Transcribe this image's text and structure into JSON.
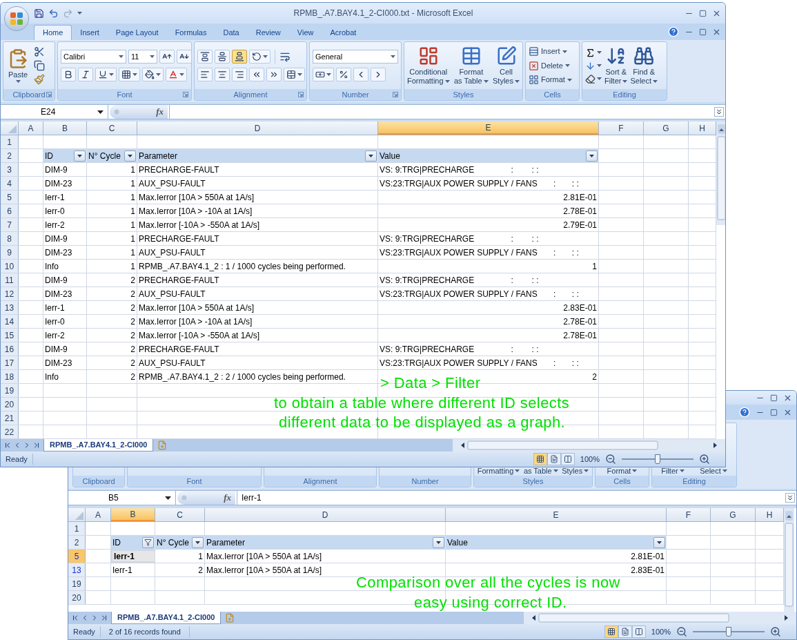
{
  "window_1": {
    "title": "RPMB_.A7.BAY4.1_2-CI000.txt - Microsoft Excel",
    "tabs": [
      {
        "label": "Home",
        "selected": true
      },
      {
        "label": "Insert",
        "selected": false
      },
      {
        "label": "Page Layout",
        "selected": false
      },
      {
        "label": "Formulas",
        "selected": false
      },
      {
        "label": "Data",
        "selected": false
      },
      {
        "label": "Review",
        "selected": false
      },
      {
        "label": "View",
        "selected": false
      },
      {
        "label": "Acrobat",
        "selected": false
      }
    ],
    "ribbon": {
      "groups": [
        {
          "kind": "clipboard",
          "label": "Clipboard",
          "paste": "Paste"
        },
        {
          "kind": "font",
          "label": "Font",
          "font_name": "Calibri",
          "font_size": "11"
        },
        {
          "kind": "alignment",
          "label": "Alignment",
          "vertical_align": [
            {
              "kind": "top",
              "selected": false
            },
            {
              "kind": "middle",
              "selected": false
            },
            {
              "kind": "bottom",
              "selected": true
            }
          ]
        },
        {
          "kind": "number",
          "label": "Number",
          "format": "General"
        },
        {
          "kind": "styles",
          "label": "Styles",
          "buttons": [
            {
              "kind": "conditional",
              "lines": [
                "Conditional",
                "Formatting"
              ]
            },
            {
              "kind": "table",
              "lines": [
                "Format",
                "as Table"
              ]
            },
            {
              "kind": "cell_styles",
              "lines": [
                "Cell",
                "Styles"
              ]
            }
          ]
        },
        {
          "kind": "cells",
          "label": "Cells",
          "buttons": [
            {
              "kind": "insert",
              "label": "Insert"
            },
            {
              "kind": "delete",
              "label": "Delete"
            },
            {
              "kind": "format",
              "label": "Format"
            }
          ]
        },
        {
          "kind": "editing",
          "label": "Editing",
          "buttons": [
            {
              "kind": "sort",
              "lines": [
                "Sort &",
                "Filter"
              ]
            },
            {
              "kind": "find",
              "lines": [
                "Find &",
                "Select"
              ]
            }
          ]
        }
      ]
    },
    "sheet": {
      "name_box": "E24",
      "fx_label": "fx",
      "columns": [
        {
          "label": "A",
          "selected": false
        },
        {
          "label": "B",
          "selected": false
        },
        {
          "label": "C",
          "selected": false
        },
        {
          "label": "D",
          "selected": false
        },
        {
          "label": "E",
          "selected": true
        },
        {
          "label": "F",
          "selected": false
        },
        {
          "label": "G",
          "selected": false
        },
        {
          "label": "H",
          "selected": false
        }
      ],
      "rows": [
        {
          "number": "1",
          "kind": "empty",
          "selected": false,
          "filtered_match": false
        },
        {
          "number": "2",
          "kind": "header",
          "selected": false,
          "filtered_match": false,
          "cells": [
            {
              "text": "ID",
              "filtered": false
            },
            {
              "text": "N° Cycle",
              "filtered": false
            },
            {
              "text": "Parameter",
              "filtered": false
            },
            {
              "text": "Value",
              "filtered": false
            }
          ]
        },
        {
          "number": "3",
          "kind": "data",
          "selected": false,
          "filtered_match": false,
          "value_right_aligned": false,
          "cells": [
            "DIM-9",
            "1",
            "PRECHARGE-FAULT",
            "VS: 9:TRG|PRECHARGE                :        : :"
          ]
        },
        {
          "number": "4",
          "kind": "data",
          "selected": false,
          "filtered_match": false,
          "value_right_aligned": false,
          "cells": [
            "DIM-23",
            "1",
            "AUX_PSU-FAULT",
            "VS:23:TRG|AUX POWER SUPPLY / FANS       :       : :"
          ]
        },
        {
          "number": "5",
          "kind": "data",
          "selected": false,
          "filtered_match": false,
          "value_right_aligned": true,
          "cells": [
            "Ierr-1",
            "1",
            "Max.Ierror [10A > 550A at 1A/s]",
            "2.81E-01"
          ]
        },
        {
          "number": "6",
          "kind": "data",
          "selected": false,
          "filtered_match": false,
          "value_right_aligned": true,
          "cells": [
            "Ierr-0",
            "1",
            "Max.Ierror [10A > -10A at 1A/s]",
            "2.78E-01"
          ]
        },
        {
          "number": "7",
          "kind": "data",
          "selected": false,
          "filtered_match": false,
          "value_right_aligned": true,
          "cells": [
            "Ierr-2",
            "1",
            "Max.Ierror [-10A > -550A at 1A/s]",
            "2.79E-01"
          ]
        },
        {
          "number": "8",
          "kind": "data",
          "selected": false,
          "filtered_match": false,
          "value_right_aligned": false,
          "cells": [
            "DIM-9",
            "1",
            "PRECHARGE-FAULT",
            "VS: 9:TRG|PRECHARGE                :        : :"
          ]
        },
        {
          "number": "9",
          "kind": "data",
          "selected": false,
          "filtered_match": false,
          "value_right_aligned": false,
          "cells": [
            "DIM-23",
            "1",
            "AUX_PSU-FAULT",
            "VS:23:TRG|AUX POWER SUPPLY / FANS       :       : :"
          ]
        },
        {
          "number": "10",
          "kind": "data",
          "selected": false,
          "filtered_match": false,
          "value_right_aligned": true,
          "cells": [
            "Info",
            "1",
            "RPMB_.A7.BAY4.1_2 : 1 / 1000 cycles being performed.",
            "1"
          ]
        },
        {
          "number": "11",
          "kind": "data",
          "selected": false,
          "filtered_match": false,
          "value_right_aligned": false,
          "cells": [
            "DIM-9",
            "2",
            "PRECHARGE-FAULT",
            "VS: 9:TRG|PRECHARGE                :        : :"
          ]
        },
        {
          "number": "12",
          "kind": "data",
          "selected": false,
          "filtered_match": false,
          "value_right_aligned": false,
          "cells": [
            "DIM-23",
            "2",
            "AUX_PSU-FAULT",
            "VS:23:TRG|AUX POWER SUPPLY / FANS       :       : :"
          ]
        },
        {
          "number": "13",
          "kind": "data",
          "selected": false,
          "filtered_match": false,
          "value_right_aligned": true,
          "cells": [
            "Ierr-1",
            "2",
            "Max.Ierror [10A > 550A at 1A/s]",
            "2.83E-01"
          ]
        },
        {
          "number": "14",
          "kind": "data",
          "selected": false,
          "filtered_match": false,
          "value_right_aligned": true,
          "cells": [
            "Ierr-0",
            "2",
            "Max.Ierror [10A > -10A at 1A/s]",
            "2.78E-01"
          ]
        },
        {
          "number": "15",
          "kind": "data",
          "selected": false,
          "filtered_match": false,
          "value_right_aligned": true,
          "cells": [
            "Ierr-2",
            "2",
            "Max.Ierror [-10A > -550A at 1A/s]",
            "2.78E-01"
          ]
        },
        {
          "number": "16",
          "kind": "data",
          "selected": false,
          "filtered_match": false,
          "value_right_aligned": false,
          "cells": [
            "DIM-9",
            "2",
            "PRECHARGE-FAULT",
            "VS: 9:TRG|PRECHARGE                :        : :"
          ]
        },
        {
          "number": "17",
          "kind": "data",
          "selected": false,
          "filtered_match": false,
          "value_right_aligned": false,
          "cells": [
            "DIM-23",
            "2",
            "AUX_PSU-FAULT",
            "VS:23:TRG|AUX POWER SUPPLY / FANS       :       : :"
          ]
        },
        {
          "number": "18",
          "kind": "data",
          "selected": false,
          "filtered_match": false,
          "value_right_aligned": true,
          "cells": [
            "Info",
            "2",
            "RPMB_.A7.BAY4.1_2 : 2 / 1000 cycles being performed.",
            "2"
          ]
        },
        {
          "number": "19",
          "kind": "empty",
          "selected": false,
          "filtered_match": false
        },
        {
          "number": "20",
          "kind": "empty",
          "selected": false,
          "filtered_match": false
        },
        {
          "number": "21",
          "kind": "empty",
          "selected": false,
          "filtered_match": false
        },
        {
          "number": "22",
          "kind": "empty",
          "selected": false,
          "filtered_match": false
        }
      ],
      "sheet_tab": "RPMB_.A7.BAY4.1_2-CI000"
    },
    "status_bar": {
      "status": "Ready",
      "views": [
        {
          "kind": "normal",
          "selected": true
        },
        {
          "kind": "page_layout",
          "selected": false
        },
        {
          "kind": "page_break",
          "selected": false
        }
      ],
      "zoom": "100%",
      "zoom_slider": {
        "level": 0.5
      }
    }
  },
  "window_2": {
    "ribbon": {
      "groups": [
        {
          "label": "Clipboard"
        },
        {
          "label": "Font"
        },
        {
          "label": "Alignment"
        },
        {
          "label": "Number"
        },
        {
          "label": "Styles",
          "buttons": [
            "Formatting",
            "as Table",
            "Styles"
          ]
        },
        {
          "label": "Cells",
          "buttons": [
            "Format"
          ]
        },
        {
          "label": "Editing",
          "buttons": [
            "Filter",
            "Select"
          ]
        }
      ]
    },
    "sheet": {
      "name_box": "B5",
      "fx_label": "fx",
      "formula": "Ierr-1",
      "columns": [
        {
          "label": "A",
          "selected": false
        },
        {
          "label": "B",
          "selected": true
        },
        {
          "label": "C",
          "selected": false
        },
        {
          "label": "D",
          "selected": false
        },
        {
          "label": "E",
          "selected": false
        },
        {
          "label": "F",
          "selected": false
        },
        {
          "label": "G",
          "selected": false
        },
        {
          "label": "H",
          "selected": false
        }
      ],
      "rows": [
        {
          "number": "1",
          "kind": "empty",
          "selected": false,
          "filtered_match": false
        },
        {
          "number": "2",
          "kind": "header",
          "selected": false,
          "filtered_match": false,
          "cells": [
            {
              "text": "ID",
              "filtered": true
            },
            {
              "text": "N° Cycle",
              "filtered": false
            },
            {
              "text": "Parameter",
              "filtered": false
            },
            {
              "text": "Value",
              "filtered": false
            }
          ]
        },
        {
          "number": "5",
          "kind": "data",
          "selected": true,
          "filtered_match": true,
          "value_right_aligned": true,
          "cells": [
            "Ierr-1",
            "1",
            "Max.Ierror [10A > 550A at 1A/s]",
            "2.81E-01"
          ]
        },
        {
          "number": "13",
          "kind": "data",
          "selected": false,
          "filtered_match": true,
          "value_right_aligned": true,
          "cells": [
            "Ierr-1",
            "2",
            "Max.Ierror [10A > 550A at 1A/s]",
            "2.83E-01"
          ]
        },
        {
          "number": "19",
          "kind": "empty",
          "selected": false,
          "filtered_match": false
        },
        {
          "number": "20",
          "kind": "empty",
          "selected": false,
          "filtered_match": false
        }
      ],
      "sheet_tab": "RPMB_.A7.BAY4.1_2-CI000"
    },
    "status_bar": {
      "status": "Ready",
      "records": "2 of 16 records found",
      "views": [
        {
          "kind": "normal",
          "selected": true
        },
        {
          "kind": "page_layout",
          "selected": false
        },
        {
          "kind": "page_break",
          "selected": false
        }
      ],
      "zoom": "100%",
      "zoom_slider": {
        "level": 0.5
      }
    }
  },
  "annotations": [
    {
      "text": "> Data > Filter"
    },
    {
      "text": "to obtain a table where different ID selects"
    },
    {
      "text": "different data to be displayed as a graph."
    },
    {
      "text": "Comparison over all the cycles is now"
    },
    {
      "text": "easy using correct ID."
    }
  ]
}
